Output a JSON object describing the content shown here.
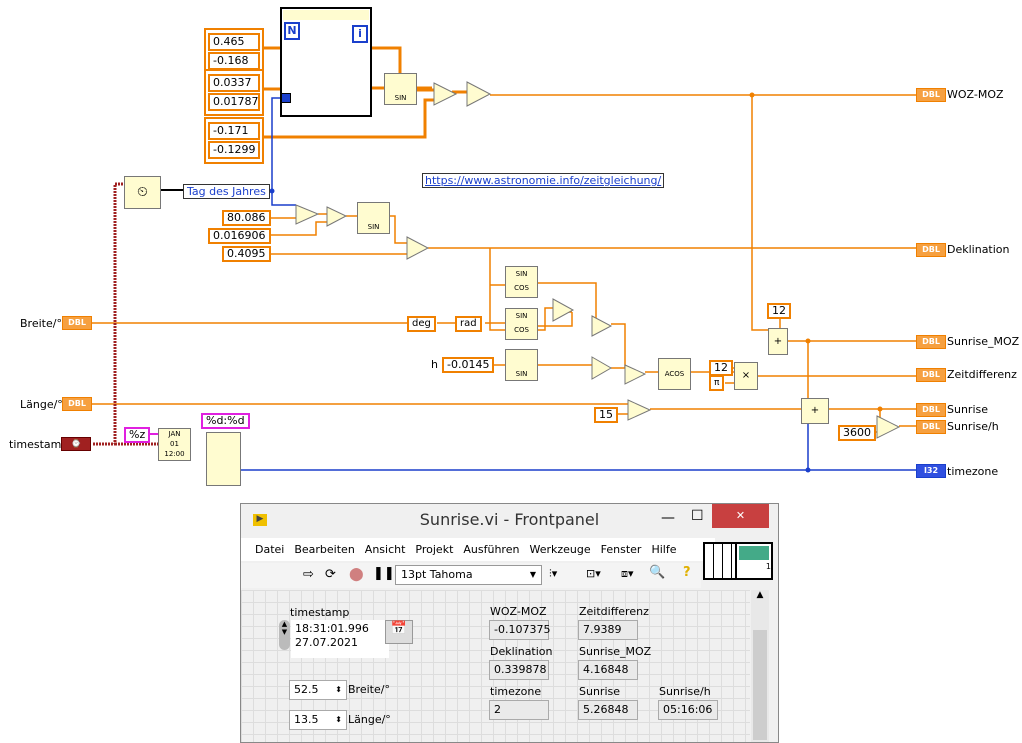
{
  "diagram": {
    "array_constants": [
      [
        "0.465",
        "-0.168"
      ],
      [
        "0.0337",
        "0.01787"
      ],
      [
        "-0.171",
        "-0.1299"
      ]
    ],
    "for_loop": {
      "count_terminal": "N",
      "iteration_terminal": "i"
    },
    "constants": {
      "c80": "80.086",
      "c016": "0.016906",
      "c4095": "0.4095",
      "h": "-0.0145",
      "h_label": "h",
      "c12a": "12",
      "c12b": "12",
      "pi": "π",
      "c15": "15",
      "c3600": "3600",
      "fmt_z": "%z",
      "fmt_dd": "%d:%d"
    },
    "tag_des_jahres": "Tag des Jahres",
    "url": "https://www.astronomie.info/zeitgleichung/",
    "inputs": {
      "breite": "Breite/°",
      "laenge": "Länge/°",
      "timestamp": "timestamp"
    },
    "indicators": {
      "woz": "WOZ-MOZ",
      "dekl": "Deklination",
      "smoz": "Sunrise_MOZ",
      "zeit": "Zeitdifferenz",
      "sunrise": "Sunrise",
      "sunrise_h": "Sunrise/h",
      "timezone": "timezone"
    },
    "type_dbl": "DBL",
    "type_i32": "I32",
    "deg": "deg",
    "rad": "rad",
    "sin": "SIN",
    "cos": "COS",
    "acos": "ACOS",
    "wire_colors": {
      "double": "#f08000",
      "integer": "#1a3fcc",
      "timestamp": "#a02020",
      "string": "#e020e0"
    }
  },
  "window": {
    "title": "Sunrise.vi - Frontpanel",
    "menu": [
      "Datei",
      "Bearbeiten",
      "Ansicht",
      "Projekt",
      "Ausführen",
      "Werkzeuge",
      "Fenster",
      "Hilfe"
    ],
    "font_select": "13pt Tahoma",
    "timestamp": {
      "label": "timestamp",
      "time": "18:31:01.996",
      "date": "27.07.2021"
    },
    "breite": {
      "label": "Breite/°",
      "value": "52.5"
    },
    "laenge": {
      "label": "Länge/°",
      "value": "13.5"
    },
    "woz": {
      "label": "WOZ-MOZ",
      "value": "-0.107375"
    },
    "zeit": {
      "label": "Zeitdifferenz",
      "value": "7.9389"
    },
    "dekl": {
      "label": "Deklination",
      "value": "0.339878"
    },
    "smoz": {
      "label": "Sunrise_MOZ",
      "value": "4.16848"
    },
    "timezone": {
      "label": "timezone",
      "value": "2"
    },
    "sunrise": {
      "label": "Sunrise",
      "value": "5.26848"
    },
    "sunrise_h": {
      "label": "Sunrise/h",
      "value": "05:16:06"
    },
    "connector_pane_number": "1"
  }
}
